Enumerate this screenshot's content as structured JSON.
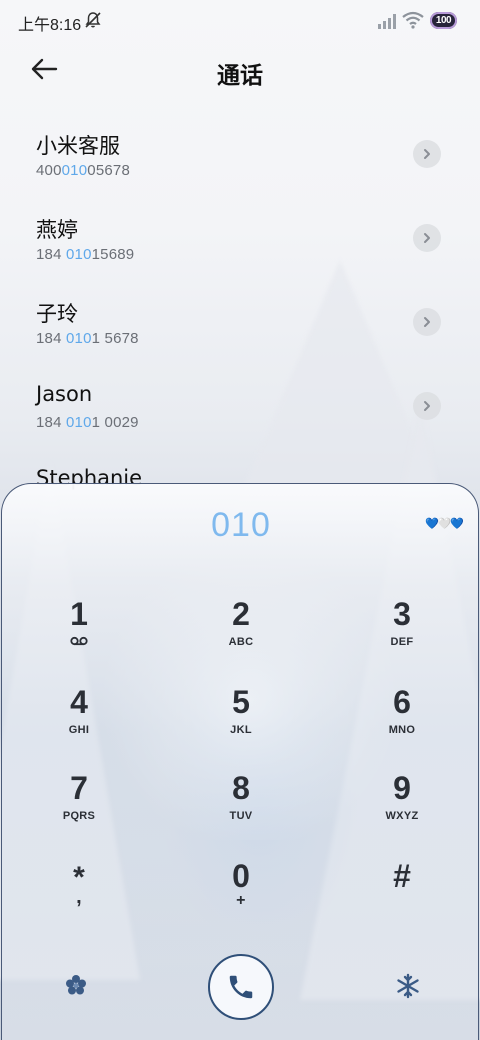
{
  "status": {
    "time": "上午8:16",
    "battery_text": "100"
  },
  "header": {
    "title": "通话"
  },
  "contacts": [
    {
      "name": "小米客服",
      "number_pre": "400",
      "number_hl": "010",
      "number_post": "05678"
    },
    {
      "name": "燕婷",
      "number_pre": "184 ",
      "number_hl": "010",
      "number_post": "15689"
    },
    {
      "name": "子玲",
      "number_pre": "184 ",
      "number_hl": "010",
      "number_post": "1 5678"
    },
    {
      "name": "Jason",
      "number_pre": "184 ",
      "number_hl": "010",
      "number_post": "1 0029"
    },
    {
      "name": "Stephanie",
      "number_pre": "",
      "number_hl": "",
      "number_post": ""
    }
  ],
  "dialpad": {
    "entered": "010",
    "hearts": [
      "💙",
      "🤍",
      "💙"
    ],
    "keys": [
      {
        "digit": "1",
        "letters": ""
      },
      {
        "digit": "2",
        "letters": "ABC"
      },
      {
        "digit": "3",
        "letters": "DEF"
      },
      {
        "digit": "4",
        "letters": "GHI"
      },
      {
        "digit": "5",
        "letters": "JKL"
      },
      {
        "digit": "6",
        "letters": "MNO"
      },
      {
        "digit": "7",
        "letters": "PQRS"
      },
      {
        "digit": "8",
        "letters": "TUV"
      },
      {
        "digit": "9",
        "letters": "WXYZ"
      },
      {
        "digit": "*",
        "letters": ","
      },
      {
        "digit": "0",
        "letters": "+"
      },
      {
        "digit": "#",
        "letters": ""
      }
    ]
  },
  "colors": {
    "accent_blue": "#5fa8ea",
    "call_ring": "#2f4f78"
  },
  "icons": {
    "back": "arrow-left",
    "detail": "chevron-right",
    "call": "phone",
    "voicemail": "voicemail",
    "left_action": "flower",
    "right_action": "snowflake"
  }
}
